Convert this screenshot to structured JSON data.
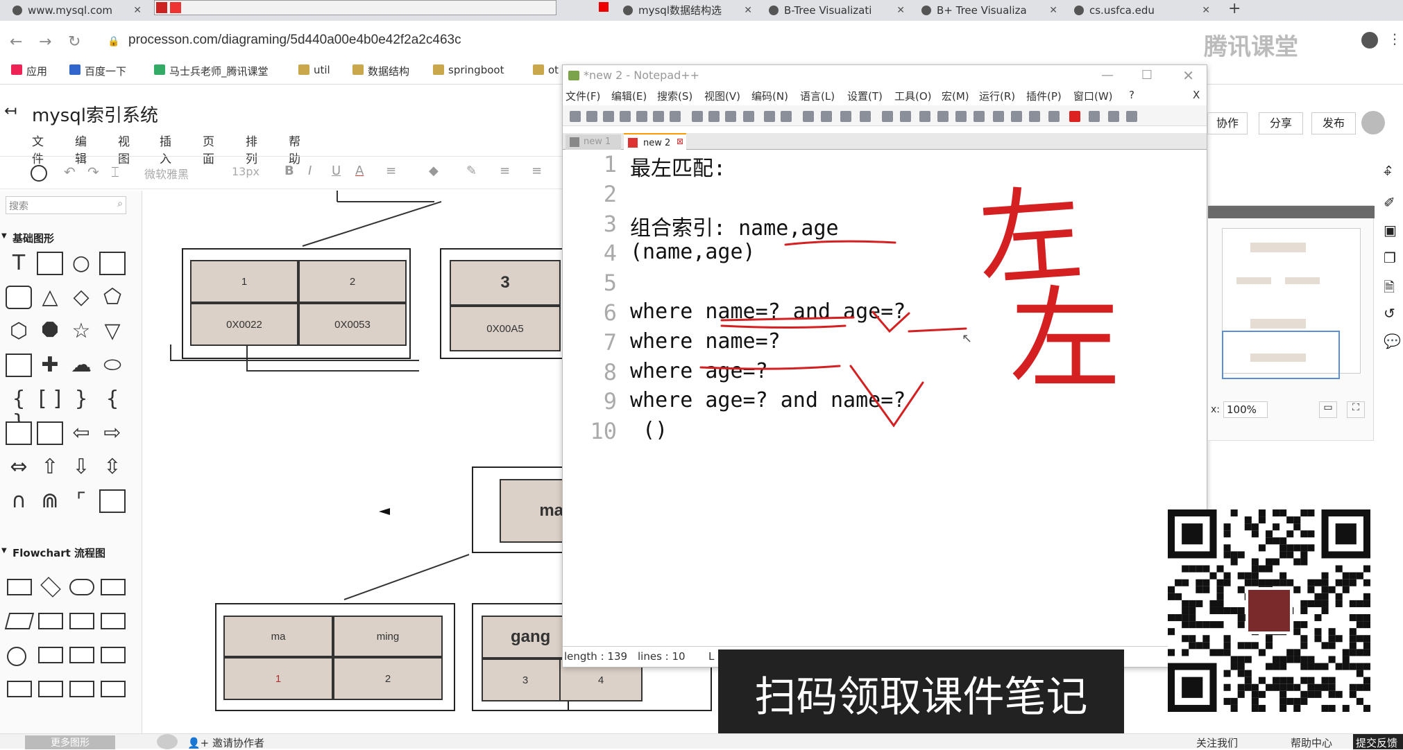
{
  "browser": {
    "tabs": [
      {
        "label": "www.mysql.com"
      },
      {
        "label": "mysql数据结构选"
      },
      {
        "label": "B-Tree Visualizati"
      },
      {
        "label": "B+ Tree Visualiza"
      },
      {
        "label": "cs.usfca.edu"
      }
    ],
    "new_tab": "+",
    "url": "processon.com/diagraming/5d440a00e4b0e42f2a2c463c",
    "bookmarks": [
      "应用",
      "百度一下",
      "马士兵老师_腾讯课堂",
      "util",
      "数据结构",
      "springboot",
      "ot"
    ],
    "watermark": "腾讯课堂"
  },
  "app": {
    "title": "mysql索引系统",
    "menu": [
      "文件",
      "编辑",
      "视图",
      "插入",
      "页面",
      "排列",
      "帮助"
    ],
    "font_name": "微软雅黑",
    "font_size": "13px",
    "right_buttons": [
      "协作",
      "分享",
      "发布"
    ],
    "search_placeholder": "搜索",
    "section_basic": "基础图形",
    "section_flowchart": "Flowchart 流程图",
    "zoom": "100%",
    "bottom_left": "更多图形",
    "invite": "邀请协作者",
    "bottom_right": [
      "关注我们",
      "帮助中心",
      "提交反馈"
    ]
  },
  "diagram": {
    "top_left_cells": [
      "1",
      "2",
      "0X0022",
      "0X0053"
    ],
    "top_mid_cells": [
      "3",
      "0X00A5"
    ],
    "middle_node": "ma",
    "bottom_left_cells": [
      "ma",
      "ming",
      "1",
      "2"
    ],
    "bottom_mid_cells": [
      "gang",
      "3",
      "4"
    ]
  },
  "notepad": {
    "title": "*new 2 - Notepad++",
    "menu": [
      "文件(F)",
      "编辑(E)",
      "搜索(S)",
      "视图(V)",
      "编码(N)",
      "语言(L)",
      "设置(T)",
      "工具(O)",
      "宏(M)",
      "运行(R)",
      "插件(P)",
      "窗口(W)",
      "?"
    ],
    "close_x": "X",
    "tabs": [
      "new 1",
      "new 2"
    ],
    "lines": [
      {
        "n": "1",
        "text": "最左匹配:"
      },
      {
        "n": "2",
        "text": ""
      },
      {
        "n": "3",
        "text": "组合索引: name,age"
      },
      {
        "n": "4",
        "text": "(name,age)"
      },
      {
        "n": "5",
        "text": ""
      },
      {
        "n": "6",
        "text": "where name=? and age=?"
      },
      {
        "n": "7",
        "text": "where name=?"
      },
      {
        "n": "8",
        "text": "where age=?"
      },
      {
        "n": "9",
        "text": "where age=? and name=?"
      },
      {
        "n": "10",
        "text": " ()"
      }
    ],
    "status_length": "length : 139",
    "status_lines": "lines : 10",
    "status_more": "L"
  },
  "handwriting": [
    "左",
    "左"
  ],
  "banner": "扫码领取课件笔记",
  "colors": {
    "annotation_red": "#d42020",
    "cell_fill": "#dcd1c8",
    "banner_bg": "#222222"
  }
}
